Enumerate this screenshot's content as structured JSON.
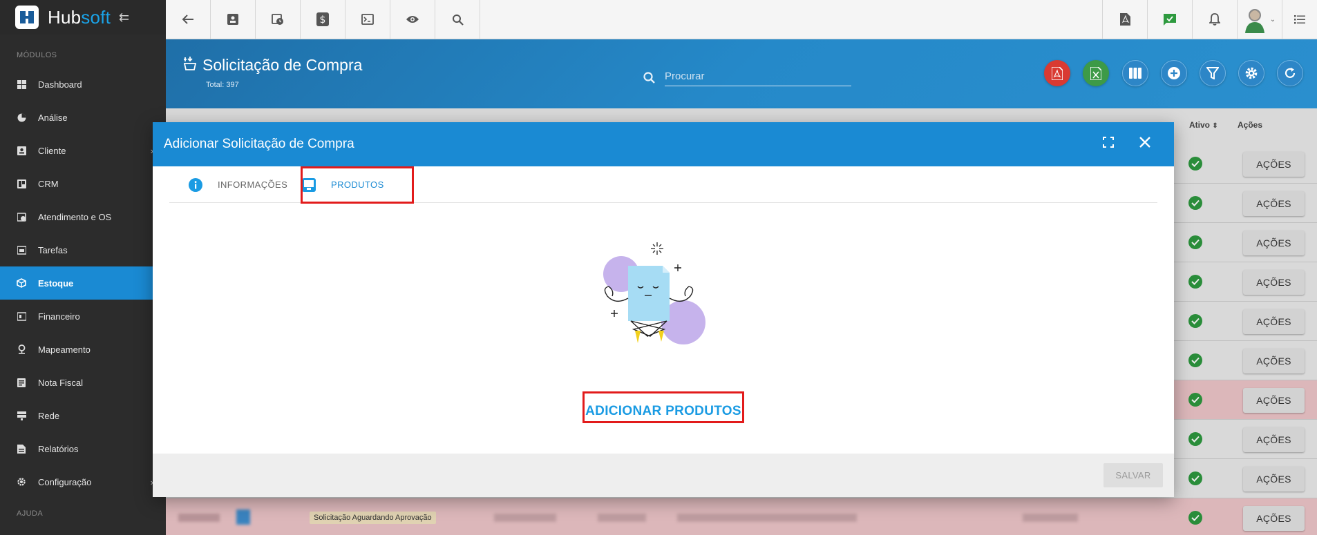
{
  "brand": {
    "name_part1": "Hub",
    "name_part2": "soft"
  },
  "sidebar": {
    "section_label": "MÓDULOS",
    "items": [
      {
        "label": "Dashboard",
        "icon": "dashboard-icon"
      },
      {
        "label": "Análise",
        "icon": "pie-chart-icon"
      },
      {
        "label": "Cliente",
        "icon": "contact-icon",
        "has_submenu": true
      },
      {
        "label": "CRM",
        "icon": "crm-icon"
      },
      {
        "label": "Atendimento e OS",
        "icon": "calendar-clock-icon"
      },
      {
        "label": "Tarefas",
        "icon": "tasks-icon"
      },
      {
        "label": "Estoque",
        "icon": "box-icon",
        "active": true
      },
      {
        "label": "Financeiro",
        "icon": "finance-icon"
      },
      {
        "label": "Mapeamento",
        "icon": "map-pin-icon"
      },
      {
        "label": "Nota Fiscal",
        "icon": "invoice-icon"
      },
      {
        "label": "Rede",
        "icon": "network-icon"
      },
      {
        "label": "Relatórios",
        "icon": "report-icon"
      },
      {
        "label": "Configuração",
        "icon": "gear-icon",
        "has_submenu": true
      }
    ],
    "help_label": "AJUDA"
  },
  "header": {
    "title": "Solicitação de Compra",
    "total": "Total: 397",
    "search_placeholder": "Procurar"
  },
  "table": {
    "columns": {
      "ativo": "Ativo",
      "acoes": "Ações"
    },
    "row_action_label": "AÇÕES",
    "rows": [
      {
        "pink": false,
        "active": true
      },
      {
        "pink": false,
        "active": true
      },
      {
        "pink": false,
        "active": true
      },
      {
        "pink": false,
        "active": true
      },
      {
        "pink": false,
        "active": true
      },
      {
        "pink": false,
        "active": true
      },
      {
        "pink": true,
        "active": true
      },
      {
        "pink": false,
        "active": true
      },
      {
        "pink": false,
        "active": true
      },
      {
        "pink": true,
        "active": true,
        "status": "Solicitação Aguardando Aprovação"
      }
    ]
  },
  "modal": {
    "title": "Adicionar Solicitação de Compra",
    "tabs": [
      {
        "label": "INFORMAÇÕES",
        "icon": "info-icon"
      },
      {
        "label": "PRODUTOS",
        "icon": "product-icon",
        "active": true
      }
    ],
    "add_products_label": "ADICIONAR PRODUTOS",
    "save_label": "SALVAR"
  },
  "colors": {
    "primary": "#1a8ad3",
    "sidebar_bg": "#2c2c2c",
    "highlight_box": "#e21b1b",
    "pdf_red": "#d93a32",
    "excel_green": "#3d9a47",
    "ok_green": "#2e9a3f"
  }
}
